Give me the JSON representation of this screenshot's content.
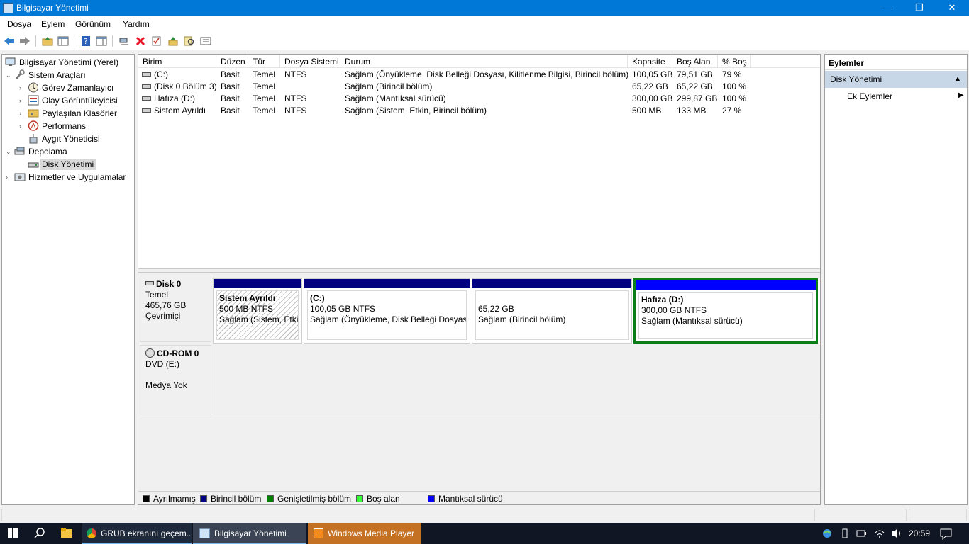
{
  "window": {
    "title": "Bilgisayar Yönetimi",
    "minimize_label": "—",
    "maximize_label": "❐",
    "close_label": "✕"
  },
  "menu": [
    "Dosya",
    "Eylem",
    "Görünüm",
    "Yardım"
  ],
  "toolbar": {
    "icons": [
      "back-icon",
      "forward-icon",
      "up-folder-icon",
      "show-hide-tree-icon",
      "help-icon",
      "properties-pane-icon",
      "connect-icon",
      "delete-icon",
      "check-icon",
      "import-icon",
      "search-icon",
      "view-icon"
    ],
    "delete_color": "#e81123"
  },
  "tree": {
    "root": "Bilgisayar Yönetimi (Yerel)",
    "system_tools": "Sistem Araçları",
    "task_scheduler": "Görev Zamanlayıcı",
    "event_viewer": "Olay Görüntüleyicisi",
    "shared_folders": "Paylaşılan Klasörler",
    "performance": "Performans",
    "device_manager": "Aygıt Yöneticisi",
    "storage": "Depolama",
    "disk_management": "Disk Yönetimi",
    "services": "Hizmetler ve Uygulamalar"
  },
  "volume_table": {
    "columns": [
      "Birim",
      "Düzen",
      "Tür",
      "Dosya Sistemi",
      "Durum",
      "Kapasite",
      "Boş Alan",
      "% Boş"
    ],
    "rows": [
      [
        "(C:)",
        "Basit",
        "Temel",
        "NTFS",
        "Sağlam (Önyükleme, Disk Belleği Dosyası, Kilitlenme Bilgisi, Birincil bölüm)",
        "100,05 GB",
        "79,51 GB",
        "79 %"
      ],
      [
        "(Disk 0 Bölüm 3)",
        "Basit",
        "Temel",
        "",
        "Sağlam (Birincil bölüm)",
        "65,22 GB",
        "65,22 GB",
        "100 %"
      ],
      [
        "Hafıza (D:)",
        "Basit",
        "Temel",
        "NTFS",
        "Sağlam (Mantıksal sürücü)",
        "300,00 GB",
        "299,87 GB",
        "100 %"
      ],
      [
        "Sistem Ayrıldı",
        "Basit",
        "Temel",
        "NTFS",
        "Sağlam (Sistem, Etkin, Birincil bölüm)",
        "500 MB",
        "133 MB",
        "27 %"
      ]
    ]
  },
  "disk0": {
    "name": "Disk 0",
    "type": "Temel",
    "size": "465,76 GB",
    "status": "Çevrimiçi",
    "partitions": [
      {
        "name": "Sistem Ayrıldı",
        "size": "500 MB NTFS",
        "status": "Sağlam (Sistem, Etkin",
        "bar": "#000080",
        "selected": false
      },
      {
        "name": "(C:)",
        "size": "100,05 GB NTFS",
        "status": "Sağlam (Önyükleme, Disk Belleği Dosyası,",
        "bar": "#000080",
        "selected": false
      },
      {
        "name": "",
        "size": "65,22 GB",
        "status": "Sağlam (Birincil bölüm)",
        "bar": "#000080",
        "selected": false
      },
      {
        "name": "Hafıza  (D:)",
        "size": "300,00 GB NTFS",
        "status": "Sağlam (Mantıksal sürücü)",
        "bar": "#0000ff",
        "selected": true
      }
    ]
  },
  "cdrom0": {
    "name": "CD-ROM 0",
    "drive": "DVD (E:)",
    "status": "Medya Yok"
  },
  "legend": [
    {
      "label": "Ayrılmamış",
      "color": "#000000"
    },
    {
      "label": "Birincil bölüm",
      "color": "#000080"
    },
    {
      "label": "Genişletilmiş bölüm",
      "color": "#008000"
    },
    {
      "label": "Boş alan",
      "color": "#33ff33"
    },
    {
      "label": "Mantıksal sürücü",
      "color": "#0000ff"
    }
  ],
  "actions": {
    "title": "Eylemler",
    "section": "Disk Yönetimi",
    "more": "Ek Eylemler"
  },
  "taskbar": {
    "chrome": "GRUB ekranını geçem...",
    "computer_mgmt": "Bilgisayar Yönetimi",
    "media_player": "Windows Media Player",
    "time": "20:59"
  }
}
